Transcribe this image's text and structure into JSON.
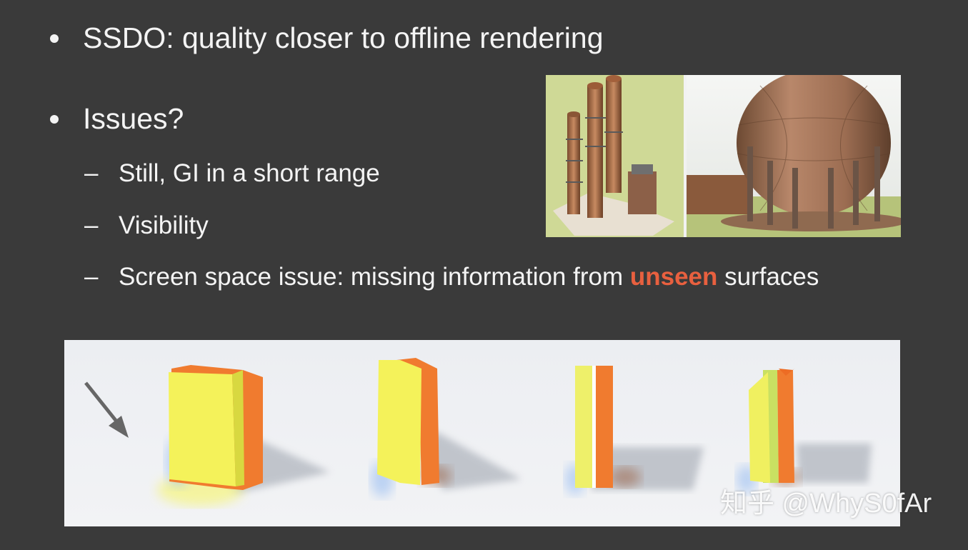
{
  "bullets": [
    {
      "text": "SSDO: quality closer to offline rendering"
    },
    {
      "text": "Issues?"
    }
  ],
  "sub_items": [
    {
      "text": "Still, GI in a short range"
    },
    {
      "text": "Visibility"
    },
    {
      "prefix": "Screen space issue: missing information from ",
      "highlight": "unseen",
      "suffix": " surfaces"
    }
  ],
  "colors": {
    "background": "#3a3a3a",
    "text": "#f4f4f4",
    "highlight": "#e8603f"
  },
  "watermark": "知乎 @WhyS0fAr"
}
